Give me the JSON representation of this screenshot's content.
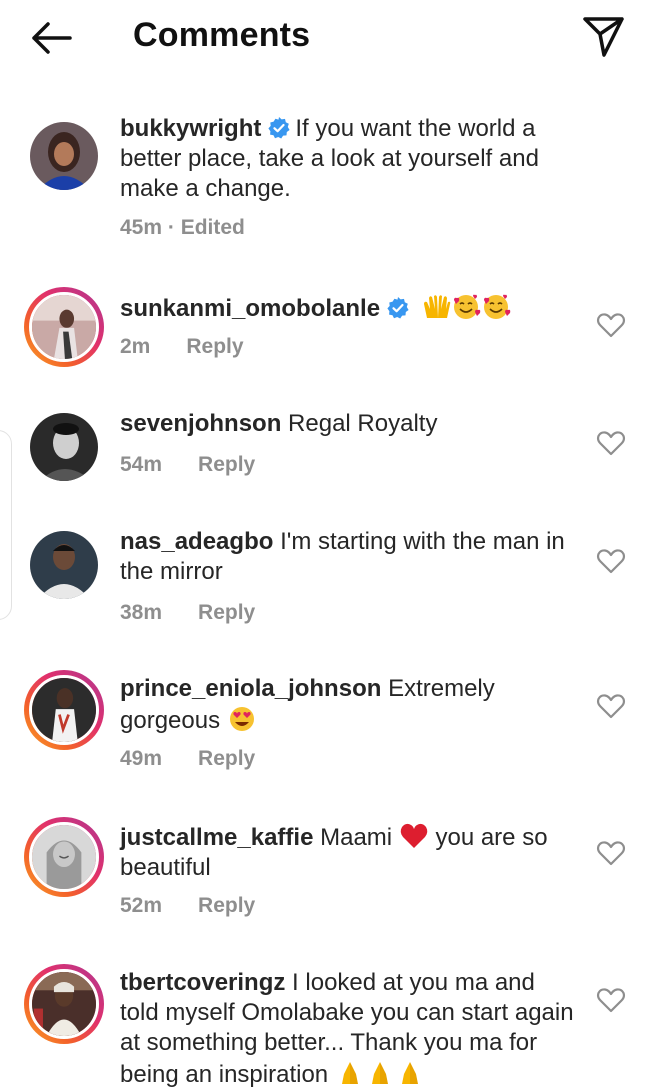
{
  "header": {
    "title": "Comments",
    "back_icon": "back-arrow-icon",
    "send_icon": "send-paper-plane-icon"
  },
  "colors": {
    "verified": "#3897f0",
    "meta_gray": "#8e8e8e",
    "text": "#262626",
    "story_ring": [
      "#f9a328",
      "#e1306c",
      "#a63bb7"
    ]
  },
  "caption": {
    "username": "bukkywright",
    "verified": true,
    "text": "If you want the world a better place, take a look at yourself and make a change.",
    "time": "45m · Edited"
  },
  "comments": [
    {
      "username": "sunkanmi_omobolanle",
      "verified": true,
      "text": "",
      "emojis": [
        "raising-hands-emoji",
        "smiling-face-with-hearts-emoji",
        "smiling-face-with-hearts-emoji"
      ],
      "time": "2m",
      "reply": "Reply"
    },
    {
      "username": "sevenjohnson",
      "text": "Regal Royalty",
      "time": "54m",
      "reply": "Reply"
    },
    {
      "username": "nas_adeagbo",
      "text": "I'm starting with the man in the mirror",
      "time": "38m",
      "reply": "Reply"
    },
    {
      "username": "prince_eniola_johnson",
      "text": "Extremely gorgeous",
      "emojis": [
        "heart-eyes-emoji"
      ],
      "time": "49m",
      "reply": "Reply"
    },
    {
      "username": "justcallme_kaffie",
      "text_before": "Maami",
      "text_after": "you are so beautiful",
      "emojis": [
        "red-heart-emoji"
      ],
      "time": "52m",
      "reply": "Reply"
    },
    {
      "username": "tbertcoveringz",
      "text": "I looked at you ma and told myself Omolabake you can start again at something better... Thank you ma for being an inspiration",
      "emojis": [
        "folded-hands-emoji",
        "folded-hands-emoji",
        "folded-hands-emoji"
      ],
      "time": "",
      "reply": ""
    }
  ]
}
